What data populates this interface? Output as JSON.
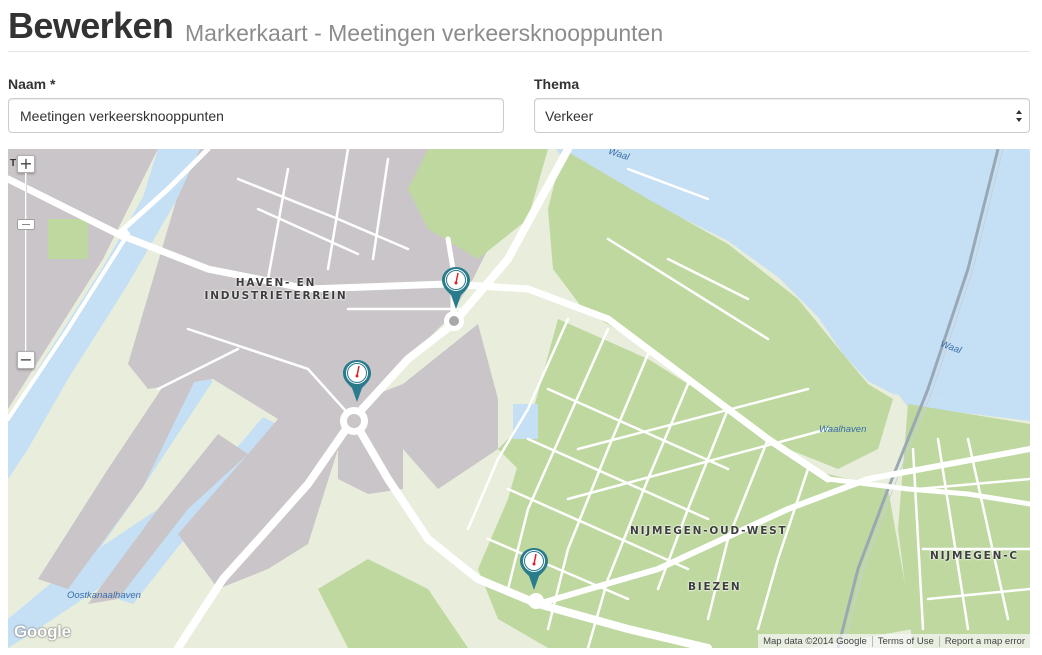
{
  "header": {
    "title": "Bewerken",
    "subtitle": "Markerkaart - Meetingen verkeersknooppunten"
  },
  "form": {
    "name_label": "Naam *",
    "name_value": "Meetingen verkeersknooppunten",
    "theme_label": "Thema",
    "theme_value": "Verkeer"
  },
  "map": {
    "district_labels": {
      "haven_line1": "HAVEN- EN",
      "haven_line2": "INDUSTRIETERREIN",
      "oud_west": "NIJMEGEN-OUD-WEST",
      "biezen": "BIEZEN",
      "centrum": "NIJMEGEN-C"
    },
    "water_labels": {
      "waal_top": "Waal",
      "waal_right": "Waal",
      "waalhaven": "Waalhaven",
      "oostkanaalhaven": "Oostkanaalhaven"
    },
    "edge_letter": "T",
    "zoom_in": "+",
    "zoom_out": "−",
    "logo": "Google",
    "attribution": {
      "map_data": "Map data ©2014 Google",
      "terms": "Terms of Use",
      "report": "Report a map error"
    },
    "marker_icon": "speedometer-marker-icon",
    "colors": {
      "water": "#c5dff5",
      "industrial": "#cac5c8",
      "park": "#bed8a0",
      "land": "#e8eedb",
      "marker": "#2a7b8c"
    }
  }
}
